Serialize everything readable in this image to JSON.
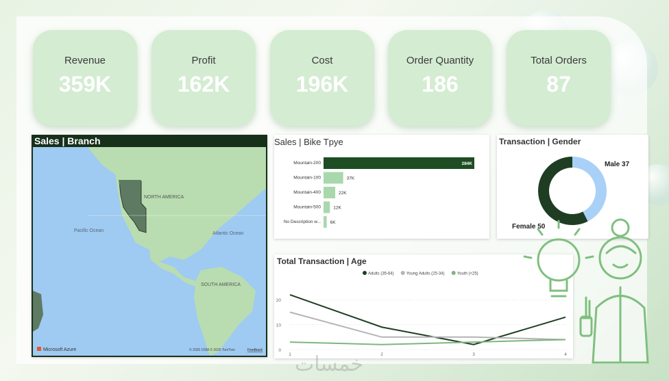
{
  "kpis": [
    {
      "title": "Revenue",
      "value": "359K"
    },
    {
      "title": "Profit",
      "value": "162K"
    },
    {
      "title": "Cost",
      "value": "196K"
    },
    {
      "title": "Order Quantity",
      "value": "186"
    },
    {
      "title": "Total Orders",
      "value": "87"
    }
  ],
  "map": {
    "title": "Sales | Branch",
    "labels": {
      "north_america": "NORTH AMERICA",
      "south_america": "SOUTH AMERICA",
      "pacific": "Pacific Ocean",
      "atlantic": "Atlantic Ocean"
    },
    "attribution_brand": "Microsoft Azure",
    "attribution_text": "© 2025 OSM © 2025 TomTom",
    "feedback": "Feedback"
  },
  "bike": {
    "title": "Sales | Bike Tpye"
  },
  "gender": {
    "title": "Transaction | Gender"
  },
  "age": {
    "title": "Total Transaction | Age"
  },
  "watermark": "خمسات",
  "colors": {
    "dark_green": "#1e4d24",
    "light_green": "#a8d8ac",
    "light_blue": "#a9d1f7",
    "kpi_bg": "#d4ecd2"
  },
  "chart_data": [
    {
      "type": "bar",
      "orientation": "horizontal",
      "title": "Sales | Bike Tpye",
      "categories": [
        "Mountain-200",
        "Mountain-100",
        "Mountain-400",
        "Mountain-500",
        "No Description w..."
      ],
      "values": [
        284000,
        37000,
        22000,
        12000,
        6000
      ],
      "labels": [
        "284K",
        "37K",
        "22K",
        "12K",
        "6K"
      ]
    },
    {
      "type": "pie",
      "variant": "donut",
      "title": "Transaction | Gender",
      "categories": [
        "Male",
        "Female"
      ],
      "values": [
        37,
        50
      ],
      "labels": [
        "Male 37",
        "Female 50"
      ]
    },
    {
      "type": "line",
      "title": "Total Transaction | Age",
      "x": [
        1,
        2,
        3,
        4
      ],
      "ylim": [
        0,
        25
      ],
      "yticks": [
        "0",
        "10",
        "20"
      ],
      "xticks": [
        "1",
        "2",
        "3",
        "4"
      ],
      "legend_position": "top",
      "series": [
        {
          "name": "Adults (35-64)",
          "values": [
            22,
            9,
            2,
            13
          ]
        },
        {
          "name": "Young Adults (25-34)",
          "values": [
            15,
            5,
            5,
            4
          ]
        },
        {
          "name": "Youth (<25)",
          "values": [
            3,
            2,
            3,
            4
          ]
        }
      ]
    }
  ]
}
